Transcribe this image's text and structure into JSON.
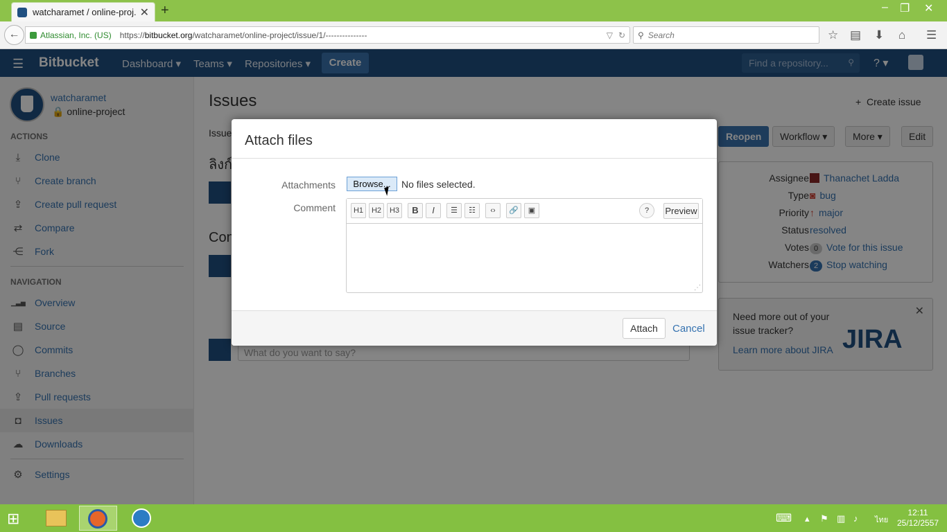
{
  "browser": {
    "tab_title": "watcharamet / online-proj...",
    "site_identity": "Atlassian, Inc. (US)",
    "url_prefix": "https://",
    "url_host": "bitbucket.org",
    "url_path": "/watcharamet/online-project/issue/1/---------------",
    "search_placeholder": "Search"
  },
  "header": {
    "logo": "Bitbucket",
    "nav": [
      "Dashboard ▾",
      "Teams ▾",
      "Repositories ▾"
    ],
    "create": "Create",
    "find_placeholder": "Find a repository...",
    "help": "? ▾",
    "user": "▾"
  },
  "sidebar": {
    "owner": "watcharamet",
    "repo": "online-project",
    "actions_head": "ACTIONS",
    "actions": [
      {
        "label": "Clone",
        "icon": "clone-icon",
        "glyph": "⤓"
      },
      {
        "label": "Create branch",
        "icon": "branch-icon",
        "glyph": "⑂"
      },
      {
        "label": "Create pull request",
        "icon": "pull-request-icon",
        "glyph": "⇪"
      },
      {
        "label": "Compare",
        "icon": "compare-icon",
        "glyph": "⇄"
      },
      {
        "label": "Fork",
        "icon": "fork-icon",
        "glyph": "⋲"
      }
    ],
    "nav_head": "NAVIGATION",
    "nav": [
      {
        "label": "Overview",
        "icon": "overview-icon",
        "glyph": "▁▃▅"
      },
      {
        "label": "Source",
        "icon": "source-icon",
        "glyph": "▤"
      },
      {
        "label": "Commits",
        "icon": "commits-icon",
        "glyph": "◯"
      },
      {
        "label": "Branches",
        "icon": "branches-icon",
        "glyph": "⑂"
      },
      {
        "label": "Pull requests",
        "icon": "pull-requests-icon",
        "glyph": "⇪"
      },
      {
        "label": "Issues",
        "icon": "issues-icon",
        "glyph": "◘"
      },
      {
        "label": "Downloads",
        "icon": "downloads-icon",
        "glyph": "☁"
      }
    ],
    "settings": {
      "label": "Settings",
      "icon": "settings-icon",
      "glyph": "⚙"
    }
  },
  "main": {
    "title": "Issues",
    "create_issue": "Create issue",
    "crumb": "Issue",
    "issue_title_fragment": "ลิงก์",
    "comments_fragment": "Con",
    "comment_placeholder": "What do you want to say?",
    "buttons": {
      "reopen": "Reopen",
      "workflow": "Workflow ▾",
      "more": "More ▾",
      "edit": "Edit"
    }
  },
  "meta": {
    "rows": [
      {
        "key": "Assignee",
        "value": "Thanachet Ladda"
      },
      {
        "key": "Type",
        "value": "bug"
      },
      {
        "key": "Priority",
        "value": "major"
      },
      {
        "key": "Status",
        "value": "resolved"
      },
      {
        "key": "Votes",
        "count": "0",
        "value": "Vote for this issue"
      },
      {
        "key": "Watchers",
        "count": "2",
        "value": "Stop watching"
      }
    ]
  },
  "jira": {
    "text": "Need more out of your issue tracker?",
    "link": "Learn more about JIRA",
    "logo": "JIRA"
  },
  "dialog": {
    "title": "Attach files",
    "attachments_label": "Attachments",
    "browse": "Browse...",
    "no_files": "No files selected.",
    "comment_label": "Comment",
    "toolbar": [
      "H1",
      "H2",
      "H3",
      "B",
      "I",
      "☰",
      "☷",
      "‹›",
      "🔗",
      "▣"
    ],
    "help": "?",
    "preview": "Preview",
    "attach": "Attach",
    "cancel": "Cancel"
  },
  "taskbar": {
    "time": "12:11",
    "date": "25/12/2557",
    "lang": "ไทย"
  },
  "colors": {
    "bitbucket_blue": "#205081",
    "link": "#3572b0",
    "taskbar_green": "#84c041"
  }
}
